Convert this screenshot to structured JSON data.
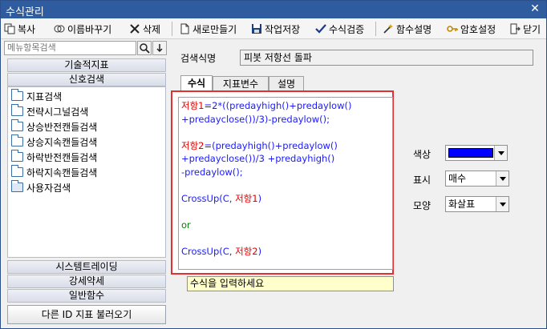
{
  "window": {
    "title": "수식관리",
    "close_glyph": "✕"
  },
  "toolbar": {
    "copy": "복사",
    "rename": "이름바꾸기",
    "delete": "삭제",
    "new": "새로만들기",
    "save": "작업저장",
    "verify": "수식검증",
    "func_help": "함수설명",
    "password": "암호설정",
    "close": "닫기"
  },
  "sidebar": {
    "search_placeholder": "메뉴항목검색",
    "categories_top": [
      "기술적지표",
      "신호검색"
    ],
    "tree_items": [
      "지표검색",
      "전략시그널검색",
      "상승반전캔들검색",
      "상승지속캔들검색",
      "하락반전캔들검색",
      "하락지속캔들검색",
      "사용자검색"
    ],
    "categories_bottom": [
      "시스템트레이딩",
      "강세약세",
      "일반함수"
    ],
    "load_button": "다른 ID 지표 불러오기"
  },
  "main": {
    "name_label": "검색식명",
    "name_value": "피봇 저항선 돌파",
    "tabs": [
      "수식",
      "지표변수",
      "설명"
    ],
    "hint": "수식을 입력하세요"
  },
  "formula": {
    "l1a": "저항1",
    "l1b": "=2*((predayhigh()+predaylow()",
    "l2a": "+predayclose())/3)-predaylow();",
    "l4a": "저항2",
    "l4b": "=(predayhigh()+predaylow()",
    "l5a": "+predayclose())/3 +predayhigh()",
    "l6a": "-predaylow();",
    "l8a": "CrossUp(C, ",
    "l8b": "저항1",
    "l8c": ")",
    "l10a": "or",
    "l12a": "CrossUp(C, ",
    "l12b": "저항2",
    "l12c": ")"
  },
  "properties": {
    "color_label": "색상",
    "color_value": "#0000ff",
    "display_label": "표시",
    "display_value": "매수",
    "shape_label": "모양",
    "shape_value": "화살표"
  }
}
